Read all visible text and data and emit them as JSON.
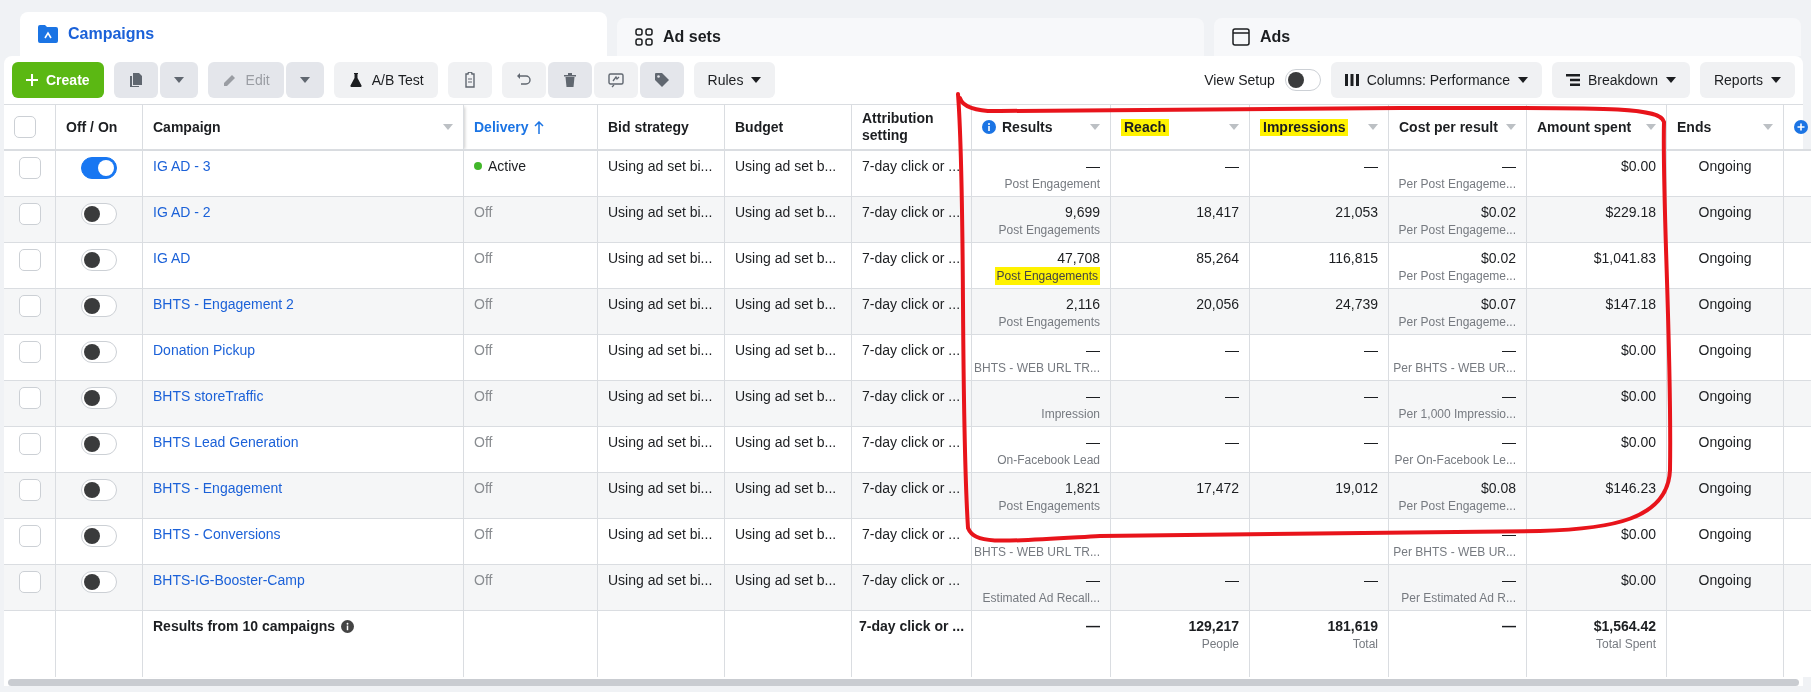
{
  "tabs": [
    {
      "label": "Campaigns",
      "kind": "folder",
      "selected": true
    },
    {
      "label": "Ad sets",
      "kind": "grid",
      "selected": false
    },
    {
      "label": "Ads",
      "kind": "window",
      "selected": false
    }
  ],
  "toolbar": {
    "create": "Create",
    "edit": {
      "label": "Edit",
      "disabled": true
    },
    "ab_test": "A/B Test",
    "rules": "Rules",
    "view_setup": {
      "label": "View Setup",
      "on": false
    },
    "columns": "Columns: Performance",
    "breakdown": "Breakdown",
    "reports": "Reports"
  },
  "select_all_checked": false,
  "columns": [
    {
      "label": "Off / On",
      "menu": false,
      "sorted": false,
      "highlighted": false
    },
    {
      "label": "Campaign",
      "menu": true,
      "sorted": false,
      "highlighted": false
    },
    {
      "label": "Delivery",
      "menu": false,
      "sorted": true,
      "highlighted": false
    },
    {
      "label": "Bid strategy",
      "menu": false,
      "sorted": false,
      "highlighted": false
    },
    {
      "label": "Budget",
      "menu": false,
      "sorted": false,
      "highlighted": false
    },
    {
      "label": "Attribution setting",
      "menu": false,
      "sorted": false,
      "highlighted": false
    },
    {
      "label": "Results",
      "menu": true,
      "info": true,
      "sorted": false,
      "highlighted": false
    },
    {
      "label": "Reach",
      "menu": true,
      "sorted": false,
      "highlighted": true
    },
    {
      "label": "Impressions",
      "menu": true,
      "sorted": false,
      "highlighted": true
    },
    {
      "label": "Cost per result",
      "menu": true,
      "sorted": false,
      "highlighted": false
    },
    {
      "label": "Amount spent",
      "menu": true,
      "sorted": false,
      "highlighted": false
    },
    {
      "label": "Ends",
      "menu": true,
      "sorted": false,
      "highlighted": false
    }
  ],
  "rows": [
    {
      "checked": false,
      "on": true,
      "name": "IG AD - 3",
      "delivery": "Active",
      "active": true,
      "bid": "Using ad set bi...",
      "budget": "Using ad set b...",
      "attribution": "7-day click or ...",
      "results": "—",
      "results_label": "Post Engagement",
      "results_highlighted": false,
      "reach": "—",
      "impressions": "—",
      "cost": "—",
      "cost_label": "Per Post Engageme...",
      "amount": "$0.00",
      "ends": "Ongoing"
    },
    {
      "checked": false,
      "on": false,
      "name": "IG AD - 2",
      "delivery": "Off",
      "active": false,
      "bid": "Using ad set bi...",
      "budget": "Using ad set b...",
      "attribution": "7-day click or ...",
      "results": "9,699",
      "results_label": "Post Engagements",
      "results_highlighted": false,
      "reach": "18,417",
      "impressions": "21,053",
      "cost": "$0.02",
      "cost_label": "Per Post Engageme...",
      "amount": "$229.18",
      "ends": "Ongoing"
    },
    {
      "checked": false,
      "on": false,
      "name": "IG AD",
      "delivery": "Off",
      "active": false,
      "bid": "Using ad set bi...",
      "budget": "Using ad set b...",
      "attribution": "7-day click or ...",
      "results": "47,708",
      "results_label": "Post Engagements",
      "results_highlighted": true,
      "reach": "85,264",
      "impressions": "116,815",
      "cost": "$0.02",
      "cost_label": "Per Post Engageme...",
      "amount": "$1,041.83",
      "ends": "Ongoing"
    },
    {
      "checked": false,
      "on": false,
      "name": "BHTS - Engagement 2",
      "delivery": "Off",
      "active": false,
      "bid": "Using ad set bi...",
      "budget": "Using ad set b...",
      "attribution": "7-day click or ...",
      "results": "2,116",
      "results_label": "Post Engagements",
      "results_highlighted": false,
      "reach": "20,056",
      "impressions": "24,739",
      "cost": "$0.07",
      "cost_label": "Per Post Engageme...",
      "amount": "$147.18",
      "ends": "Ongoing"
    },
    {
      "checked": false,
      "on": false,
      "name": "Donation Pickup",
      "delivery": "Off",
      "active": false,
      "bid": "Using ad set bi...",
      "budget": "Using ad set b...",
      "attribution": "7-day click or ...",
      "results": "—",
      "results_label": "BHTS - WEB URL TR...",
      "results_highlighted": false,
      "reach": "—",
      "impressions": "—",
      "cost": "—",
      "cost_label": "Per BHTS - WEB UR...",
      "amount": "$0.00",
      "ends": "Ongoing"
    },
    {
      "checked": false,
      "on": false,
      "name": "BHTS storeTraffic",
      "delivery": "Off",
      "active": false,
      "bid": "Using ad set bi...",
      "budget": "Using ad set b...",
      "attribution": "7-day click or ...",
      "results": "—",
      "results_label": "Impression",
      "results_highlighted": false,
      "reach": "—",
      "impressions": "—",
      "cost": "—",
      "cost_label": "Per 1,000 Impressio...",
      "amount": "$0.00",
      "ends": "Ongoing"
    },
    {
      "checked": false,
      "on": false,
      "name": "BHTS Lead Generation",
      "delivery": "Off",
      "active": false,
      "bid": "Using ad set bi...",
      "budget": "Using ad set b...",
      "attribution": "7-day click or ...",
      "results": "—",
      "results_label": "On-Facebook Lead",
      "results_highlighted": false,
      "reach": "—",
      "impressions": "—",
      "cost": "—",
      "cost_label": "Per On-Facebook Le...",
      "amount": "$0.00",
      "ends": "Ongoing"
    },
    {
      "checked": false,
      "on": false,
      "name": "BHTS - Engagement",
      "delivery": "Off",
      "active": false,
      "bid": "Using ad set bi...",
      "budget": "Using ad set b...",
      "attribution": "7-day click or ...",
      "results": "1,821",
      "results_label": "Post Engagements",
      "results_highlighted": false,
      "reach": "17,472",
      "impressions": "19,012",
      "cost": "$0.08",
      "cost_label": "Per Post Engageme...",
      "amount": "$146.23",
      "ends": "Ongoing"
    },
    {
      "checked": false,
      "on": false,
      "name": "BHTS - Conversions",
      "delivery": "Off",
      "active": false,
      "bid": "Using ad set bi...",
      "budget": "Using ad set b...",
      "attribution": "7-day click or ...",
      "results_label": "BHTS - WEB URL TR...",
      "results_highlighted": false,
      "cost": "—",
      "cost_label": "Per BHTS - WEB UR...",
      "amount": "$0.00",
      "ends": "Ongoing"
    },
    {
      "checked": false,
      "on": false,
      "name": "BHTS-IG-Booster-Camp",
      "delivery": "Off",
      "active": false,
      "bid": "Using ad set bi...",
      "budget": "Using ad set b...",
      "attribution": "7-day click or ...",
      "results": "—",
      "results_label": "Estimated Ad Recall...",
      "results_highlighted": false,
      "reach": "—",
      "impressions": "—",
      "cost": "—",
      "cost_label": "Per Estimated Ad R...",
      "amount": "$0.00",
      "ends": "Ongoing"
    }
  ],
  "summary": {
    "label": "Results from 10 campaigns",
    "attribution": "7-day click or ...",
    "results": "—",
    "reach": "129,217",
    "reach_label": "People",
    "impressions": "181,619",
    "impressions_label": "Total",
    "cost": "—",
    "amount": "$1,564.42",
    "amount_label": "Total Spent"
  }
}
